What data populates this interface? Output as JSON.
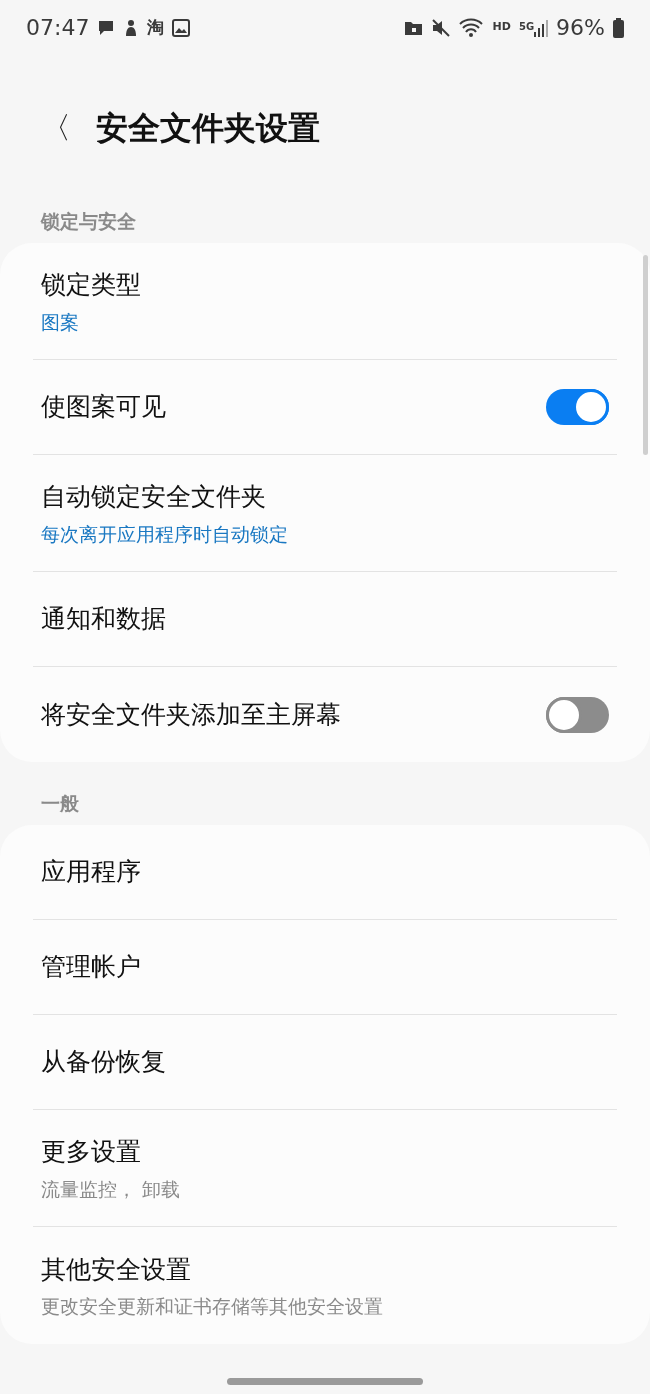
{
  "status_bar": {
    "time": "07:47",
    "app_glyph": "淘",
    "network_label": "HD",
    "generation": "5G",
    "battery": "96%"
  },
  "header": {
    "back_glyph": "〈",
    "title": "安全文件夹设置"
  },
  "sections": [
    {
      "header": "锁定与安全",
      "items": [
        {
          "kind": "link",
          "title": "锁定类型",
          "subtitle": "图案",
          "color": "#1a78c2"
        },
        {
          "kind": "toggle",
          "title": "使图案可见",
          "on": true
        },
        {
          "kind": "link",
          "title": "自动锁定安全文件夹",
          "subtitle": "每次离开应用程序时自动锁定",
          "color": "#1a78c2"
        },
        {
          "kind": "link",
          "title": "通知和数据"
        },
        {
          "kind": "toggle",
          "title": "将安全文件夹添加至主屏幕",
          "on": false
        }
      ]
    },
    {
      "header": "一般",
      "items": [
        {
          "kind": "link",
          "title": "应用程序"
        },
        {
          "kind": "link",
          "title": "管理帐户"
        },
        {
          "kind": "link",
          "title": "从备份恢复"
        },
        {
          "kind": "link",
          "title": "更多设置",
          "subtitle": "流量监控， 卸载",
          "color": "#8a8a8a"
        },
        {
          "kind": "link",
          "title": "其他安全设置",
          "subtitle": "更改安全更新和证书存储等其他安全设置",
          "color": "#8a8a8a"
        }
      ]
    }
  ]
}
